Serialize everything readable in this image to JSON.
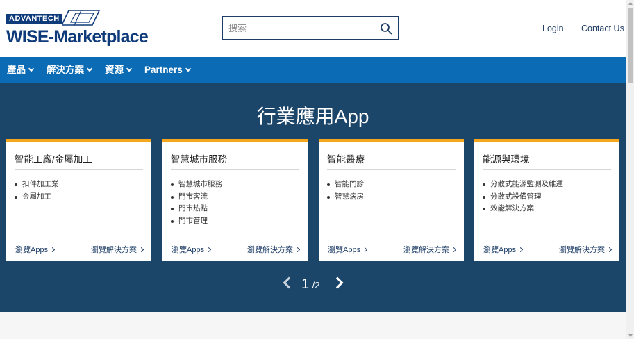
{
  "header": {
    "logo_brand": "ADVANTECH",
    "logo_product": "WISE-Marketplace",
    "search_placeholder": "搜索",
    "search_icon": "search-icon",
    "login_label": "Login",
    "contact_label": "Contact Us"
  },
  "nav": {
    "items": [
      {
        "label": "產品"
      },
      {
        "label": "解決方案"
      },
      {
        "label": "資源"
      },
      {
        "label": "Partners"
      }
    ]
  },
  "industry": {
    "title": "行業應用App",
    "cards": [
      {
        "title": "智能工廠/金屬加工",
        "items": [
          "扣件加工業",
          "金屬加工"
        ],
        "apps_link": "瀏覽Apps",
        "solutions_link": "瀏覽解決方案"
      },
      {
        "title": "智慧城市服務",
        "items": [
          "智慧城市服務",
          "門市客流",
          "門市热點",
          "門市管理"
        ],
        "apps_link": "瀏覽Apps",
        "solutions_link": "瀏覽解決方案"
      },
      {
        "title": "智能醫療",
        "items": [
          "智能門診",
          "智慧病房"
        ],
        "apps_link": "瀏覽Apps",
        "solutions_link": "瀏覽解決方案"
      },
      {
        "title": "能源與環境",
        "items": [
          "分散式能源監測及維運",
          "分散式設備管理",
          "效能解決方案"
        ],
        "apps_link": "瀏覽Apps",
        "solutions_link": "瀏覽解決方案"
      }
    ],
    "pager": {
      "current": "1",
      "total": "/2"
    }
  },
  "colors": {
    "nav_bg": "#0b6cb5",
    "section_bg": "#1b4569",
    "card_accent": "#f4a61d",
    "brand_navy": "#0f3b7a"
  }
}
